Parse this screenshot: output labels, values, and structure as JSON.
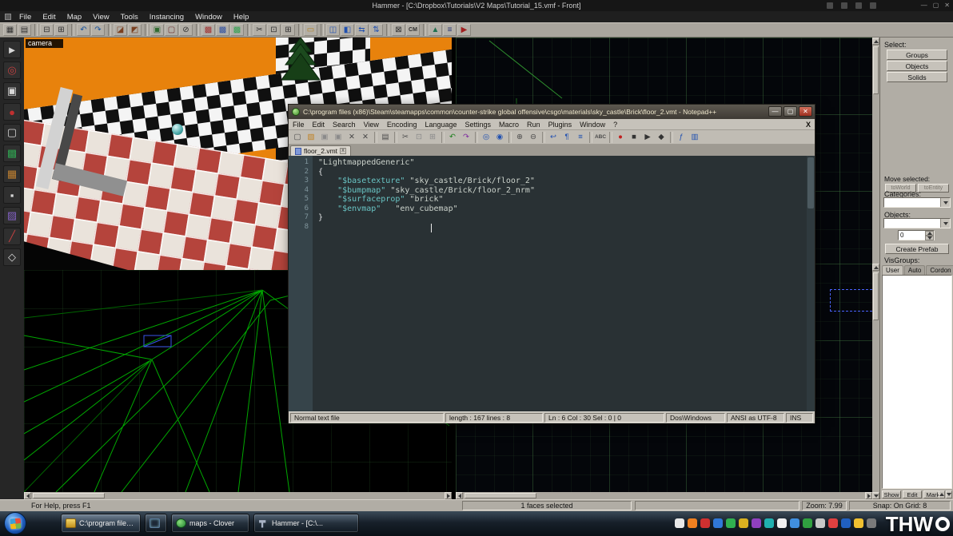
{
  "glyphs": {
    "minimize": "—",
    "maximize": "▢",
    "close": "✕"
  },
  "hammer": {
    "title": "Hammer - [C:\\Dropbox\\Tutorials\\V2 Maps\\Tutorial_15.vmf - Front]",
    "menus": [
      "File",
      "Edit",
      "Map",
      "View",
      "Tools",
      "Instancing",
      "Window",
      "Help"
    ],
    "toolbar": [
      {
        "name": "toggle-grid",
        "glyph": "▦",
        "color": "#2f2f2f"
      },
      {
        "name": "toggle-3d-grid",
        "glyph": "▤",
        "color": "#2f2f2f"
      },
      {
        "sep": true
      },
      {
        "name": "smaller-grid",
        "glyph": "⊟",
        "color": "#2f2f2f"
      },
      {
        "name": "larger-grid",
        "glyph": "⊞",
        "color": "#2f2f2f"
      },
      {
        "sep": true
      },
      {
        "name": "undo",
        "glyph": "↶",
        "color": "#14509c"
      },
      {
        "name": "redo",
        "glyph": "↷",
        "color": "#14509c"
      },
      {
        "sep": true
      },
      {
        "name": "carve",
        "glyph": "◪",
        "color": "#7a4020"
      },
      {
        "name": "make-hollow",
        "glyph": "◩",
        "color": "#7a4020"
      },
      {
        "sep": true
      },
      {
        "name": "group",
        "glyph": "▣",
        "color": "#2f6a2f"
      },
      {
        "name": "ungroup",
        "glyph": "▢",
        "color": "#6a2f2f"
      },
      {
        "name": "ignore-groups",
        "glyph": "⊘",
        "color": "#2f2f2f"
      },
      {
        "sep": true
      },
      {
        "name": "hide-selected",
        "glyph": "▩",
        "color": "#a03030"
      },
      {
        "name": "hide-unselected",
        "glyph": "▩",
        "color": "#3050a0"
      },
      {
        "name": "show-all",
        "glyph": "▩",
        "color": "#30a050"
      },
      {
        "sep": true
      },
      {
        "name": "cut",
        "glyph": "✂",
        "color": "#2f2f2f"
      },
      {
        "name": "copy",
        "glyph": "⊡",
        "color": "#2f2f2f"
      },
      {
        "name": "paste",
        "glyph": "⊞",
        "color": "#2f2f2f"
      },
      {
        "sep": true
      },
      {
        "name": "cordon",
        "glyph": "▭",
        "color": "#b08020"
      },
      {
        "sep": true
      },
      {
        "name": "select-touching",
        "glyph": "◫",
        "color": "#2050b0"
      },
      {
        "name": "select-inside",
        "glyph": "◧",
        "color": "#2050b0"
      },
      {
        "name": "flip-horizontal",
        "glyph": "⇆",
        "color": "#2050b0"
      },
      {
        "name": "flip-vertical",
        "glyph": "⇅",
        "color": "#2050b0"
      },
      {
        "sep": true
      },
      {
        "name": "texture-lock",
        "glyph": "⊠",
        "color": "#2f2f2f"
      },
      {
        "name": "cubemap",
        "glyph": "CM",
        "color": "#2f2f2f",
        "small": true
      },
      {
        "sep": true
      },
      {
        "name": "displacement",
        "glyph": "▲",
        "color": "#207050"
      },
      {
        "name": "entity-report",
        "glyph": "≡",
        "color": "#203070"
      },
      {
        "name": "run-map",
        "glyph": "▶",
        "color": "#a02020"
      }
    ],
    "tools": [
      {
        "name": "selection-tool",
        "glyph": "►",
        "color": "#d8d8d8"
      },
      {
        "name": "magnify-tool",
        "glyph": "◎",
        "color": "#c04040"
      },
      {
        "name": "camera-tool",
        "glyph": "▣",
        "color": "#d8d8d8"
      },
      {
        "name": "entity-tool",
        "glyph": "●",
        "color": "#c03030"
      },
      {
        "name": "block-tool",
        "glyph": "▢",
        "color": "#d8d8d8"
      },
      {
        "name": "texture-application-tool",
        "glyph": "▩",
        "color": "#30a050"
      },
      {
        "name": "apply-texture-tool",
        "glyph": "▦",
        "color": "#c08030"
      },
      {
        "name": "decal-tool",
        "glyph": "▪",
        "color": "#d8d8d8"
      },
      {
        "name": "overlay-tool",
        "glyph": "▨",
        "color": "#8060c0"
      },
      {
        "name": "clipping-tool",
        "glyph": "╱",
        "color": "#c04040"
      },
      {
        "name": "vertex-tool",
        "glyph": "◇",
        "color": "#d8d8d8"
      }
    ],
    "viewport3d": {
      "camera_label": "camera"
    },
    "right_panel": {
      "select_label": "Select:",
      "select_buttons": [
        "Groups",
        "Objects",
        "Solids"
      ],
      "move_label": "Move selected:",
      "move_buttons": [
        "toWorld",
        "toEntity"
      ],
      "categories_label": "Categories:",
      "objects_label": "Objects:",
      "object_count": "0",
      "create_prefab_label": "Create Prefab",
      "visgroups_label": "VisGroups:",
      "visgroup_tabs": [
        "User",
        "Auto",
        "Cordon"
      ],
      "visgroup_buttons": [
        "Show",
        "Edit",
        "Mark"
      ]
    },
    "statusbar": {
      "help": "For Help, press F1",
      "selection": "1 faces selected",
      "coord": "",
      "zoom": "Zoom: 7.99",
      "snap": "Snap: On Grid: 8"
    }
  },
  "notepadpp": {
    "title": "C:\\program files (x86)\\Steam\\steamapps\\common\\counter-strike global offensive\\csgo\\materials\\sky_castle\\Brick\\floor_2.vmt - Notepad++",
    "menus": [
      "File",
      "Edit",
      "Search",
      "View",
      "Encoding",
      "Language",
      "Settings",
      "Macro",
      "Run",
      "Plugins",
      "Window",
      "?"
    ],
    "menu_close": "X",
    "toolbar": [
      {
        "name": "new-file",
        "glyph": "▢",
        "color": "#4a4a4a"
      },
      {
        "name": "open-file",
        "glyph": "▧",
        "color": "#c08020"
      },
      {
        "name": "save-file",
        "glyph": "▣",
        "color": "#8a8a8a"
      },
      {
        "name": "save-all",
        "glyph": "▣",
        "color": "#8a8a8a"
      },
      {
        "name": "close-file",
        "glyph": "✕",
        "color": "#4a4a4a"
      },
      {
        "name": "close-all",
        "glyph": "✕",
        "color": "#4a4a4a"
      },
      {
        "sep": true
      },
      {
        "name": "print",
        "glyph": "▤",
        "color": "#4a4a4a"
      },
      {
        "sep": true
      },
      {
        "name": "cut",
        "glyph": "✂",
        "color": "#4a4a4a"
      },
      {
        "name": "copy",
        "glyph": "⊡",
        "color": "#8a8a8a"
      },
      {
        "name": "paste",
        "glyph": "⊞",
        "color": "#8a8a8a"
      },
      {
        "sep": true
      },
      {
        "name": "undo",
        "glyph": "↶",
        "color": "#208020"
      },
      {
        "name": "redo",
        "glyph": "↷",
        "color": "#8030a0"
      },
      {
        "sep": true
      },
      {
        "name": "find",
        "glyph": "◎",
        "color": "#2050b0"
      },
      {
        "name": "replace",
        "glyph": "◉",
        "color": "#2050b0"
      },
      {
        "sep": true
      },
      {
        "name": "zoom-in",
        "glyph": "⊕",
        "color": "#4a4a4a"
      },
      {
        "name": "zoom-out",
        "glyph": "⊖",
        "color": "#4a4a4a"
      },
      {
        "sep": true
      },
      {
        "name": "word-wrap",
        "glyph": "↩",
        "color": "#2050b0"
      },
      {
        "name": "show-all-characters",
        "glyph": "¶",
        "color": "#2050b0"
      },
      {
        "name": "indent-guide",
        "glyph": "≡",
        "color": "#2050b0"
      },
      {
        "sep": true
      },
      {
        "name": "spell-check",
        "glyph": "ABC",
        "color": "#4a4a4a",
        "small": true
      },
      {
        "sep": true
      },
      {
        "name": "record-macro",
        "glyph": "●",
        "color": "#c02020"
      },
      {
        "name": "stop-macro",
        "glyph": "■",
        "color": "#333333"
      },
      {
        "name": "play-macro",
        "glyph": "▶",
        "color": "#333333"
      },
      {
        "name": "save-macro",
        "glyph": "◆",
        "color": "#333333"
      },
      {
        "sep": true
      },
      {
        "name": "function-list",
        "glyph": "ƒ",
        "color": "#2050b0"
      },
      {
        "name": "document-map",
        "glyph": "▥",
        "color": "#2050b0"
      }
    ],
    "tab": {
      "label": "floor_2.vmt",
      "close": "x"
    },
    "code": [
      {
        "num": "1",
        "segs": [
          {
            "t": "\"LightmappedGeneric\"",
            "c": "str"
          }
        ]
      },
      {
        "num": "2",
        "segs": [
          {
            "t": "{",
            "c": "pln"
          }
        ]
      },
      {
        "num": "3",
        "segs": [
          {
            "t": "    ",
            "c": "pln"
          },
          {
            "t": "\"$basetexture\"",
            "c": "key"
          },
          {
            "t": " ",
            "c": "pln"
          },
          {
            "t": "\"sky_castle/Brick/floor_2\"",
            "c": "str"
          }
        ]
      },
      {
        "num": "4",
        "segs": [
          {
            "t": "    ",
            "c": "pln"
          },
          {
            "t": "\"$bumpmap\"",
            "c": "key"
          },
          {
            "t": " ",
            "c": "pln"
          },
          {
            "t": "\"sky_castle/Brick/floor_2_nrm\"",
            "c": "str"
          }
        ]
      },
      {
        "num": "5",
        "segs": [
          {
            "t": "    ",
            "c": "pln"
          },
          {
            "t": "\"$surfaceprop\"",
            "c": "key"
          },
          {
            "t": " ",
            "c": "pln"
          },
          {
            "t": "\"brick\"",
            "c": "str"
          }
        ]
      },
      {
        "num": "6",
        "segs": [
          {
            "t": "    ",
            "c": "pln"
          },
          {
            "t": "\"$envmap\"",
            "c": "key"
          },
          {
            "t": "   ",
            "c": "pln"
          },
          {
            "t": "\"env_cubemap\"",
            "c": "str"
          }
        ]
      },
      {
        "num": "7",
        "segs": [
          {
            "t": "}",
            "c": "pln"
          }
        ]
      },
      {
        "num": "8",
        "segs": []
      }
    ],
    "statusbar": {
      "doc_type": "Normal text file",
      "length_info": "length : 167    lines : 8",
      "cursor_info": "Ln : 6    Col : 30    Sel : 0 | 0",
      "eol": "Dos\\Windows",
      "encoding": "ANSI as UTF-8",
      "insert_mode": "INS"
    }
  },
  "taskbar": {
    "items": [
      {
        "icon": "folder",
        "label": "C:\\program files (...",
        "active": true
      },
      {
        "icon": "preview",
        "label": ""
      },
      {
        "icon": "clover",
        "label": "maps - Clover"
      },
      {
        "icon": "hammer",
        "label": "Hammer - [C:\\..."
      }
    ],
    "tray": [
      "#e8e8e8",
      "#f08020",
      "#d03030",
      "#3078d8",
      "#30b050",
      "#d8b020",
      "#9040c0",
      "#20b0b0",
      "#f0f0f0",
      "#4090e0",
      "#30a040",
      "#c8c8c8",
      "#e04040",
      "#2060c0",
      "#f0c030",
      "#7a7a7a"
    ],
    "watermark": "THW"
  }
}
